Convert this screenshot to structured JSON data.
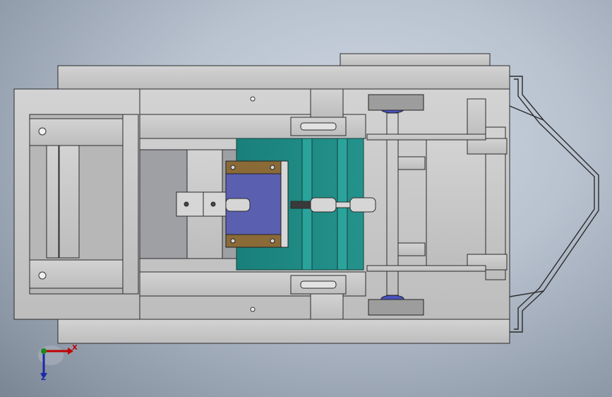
{
  "window": {
    "background_top": "#cfd7e2",
    "background_bottom": "#7a8593"
  },
  "model": {
    "part_color": "#c8c8c8",
    "edge_color": "#2b2b2b",
    "accent_teal": "#1f8c86",
    "accent_blue": "#5a5fb0",
    "accent_brown": "#8a6a36"
  },
  "triad": {
    "x_label": "X",
    "z_label": "Z",
    "x_color": "#c00000",
    "y_color": "#1a8a1a",
    "z_color": "#1a2aa8"
  }
}
